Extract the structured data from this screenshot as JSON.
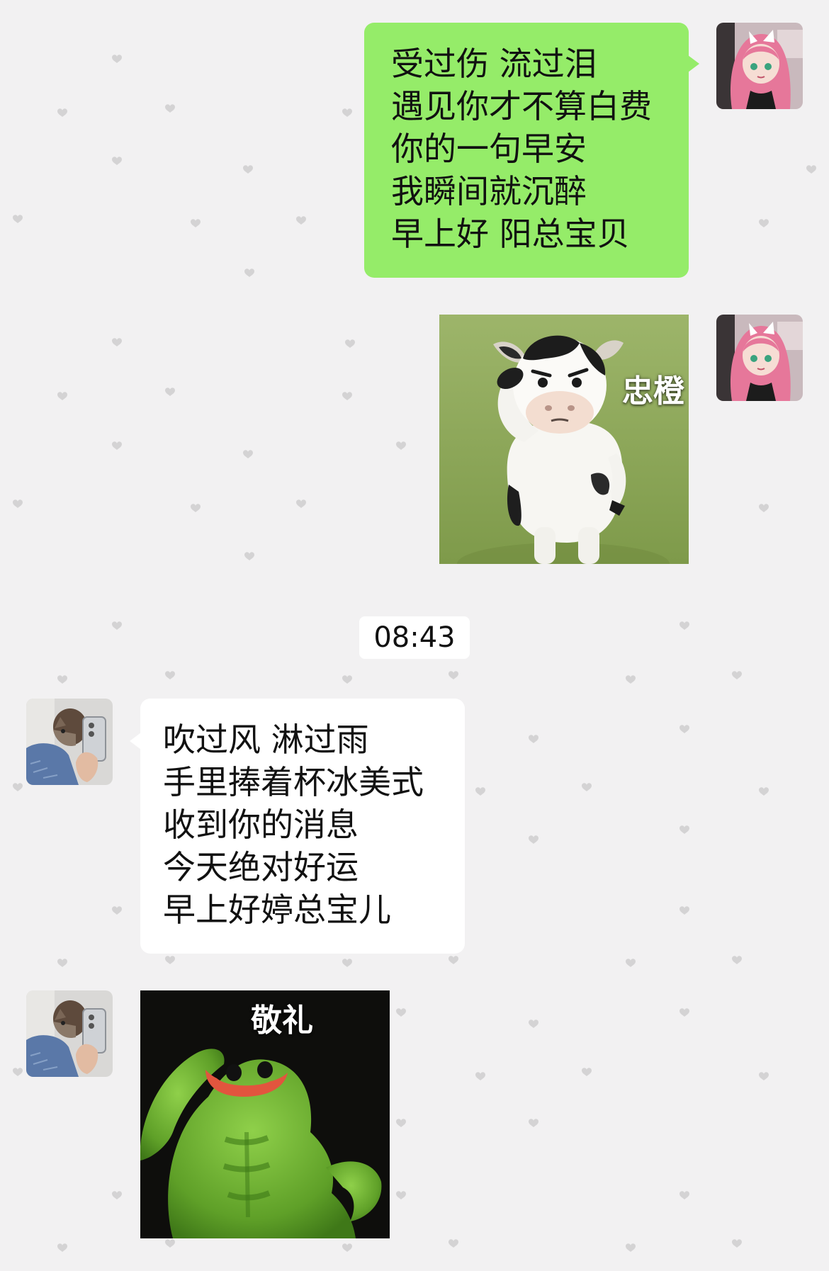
{
  "conversation": {
    "messages": [
      {
        "sender": "me",
        "type": "text",
        "lines": [
          "受过伤 流过泪",
          "遇见你才不算白费",
          "你的一句早安",
          "我瞬间就沉醉",
          "早上好 阳总宝贝"
        ]
      },
      {
        "sender": "me",
        "type": "sticker",
        "caption": "忠橙"
      },
      {
        "sender": "system",
        "type": "timestamp",
        "time": "08:43"
      },
      {
        "sender": "other",
        "type": "text",
        "lines": [
          "吹过风 淋过雨",
          "手里捧着杯冰美式",
          "收到你的消息",
          "今天绝对好运",
          "早上好婷总宝儿"
        ]
      },
      {
        "sender": "other",
        "type": "sticker",
        "caption": "敬礼"
      }
    ]
  },
  "theme": {
    "background": "#f2f1f2",
    "my_bubble": "#95ec69",
    "their_bubble": "#ffffff",
    "heart_color": "#d4d3d4"
  }
}
